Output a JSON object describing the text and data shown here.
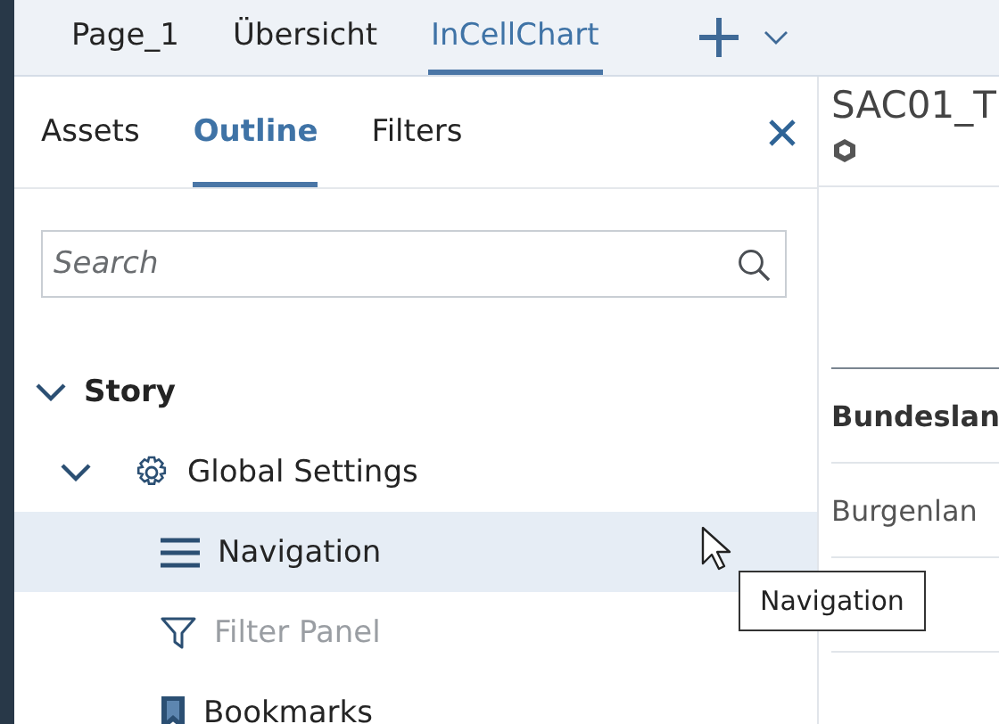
{
  "page_tabs": [
    {
      "label": "Page_1",
      "selected": false
    },
    {
      "label": "Übersicht",
      "selected": false
    },
    {
      "label": "InCellChart",
      "selected": true
    }
  ],
  "panel": {
    "tabs": [
      {
        "label": "Assets",
        "selected": false
      },
      {
        "label": "Outline",
        "selected": true
      },
      {
        "label": "Filters",
        "selected": false
      }
    ],
    "search": {
      "placeholder": "Search"
    },
    "tree": [
      {
        "label": "Story",
        "kind": "root",
        "expanded": true,
        "children": [
          {
            "label": "Global Settings",
            "kind": "settings",
            "expanded": true,
            "children": [
              {
                "label": "Navigation",
                "kind": "navigation",
                "selected": true,
                "disabled": false
              },
              {
                "label": "Filter Panel",
                "kind": "filter",
                "selected": false,
                "disabled": true
              },
              {
                "label": "Bookmarks",
                "kind": "bookmark",
                "selected": false,
                "disabled": false
              }
            ]
          }
        ]
      }
    ]
  },
  "widget": {
    "title": "SAC01_T",
    "header": "Bundeslan",
    "rows": [
      "Burgenlan"
    ]
  },
  "tooltip": "Navigation"
}
